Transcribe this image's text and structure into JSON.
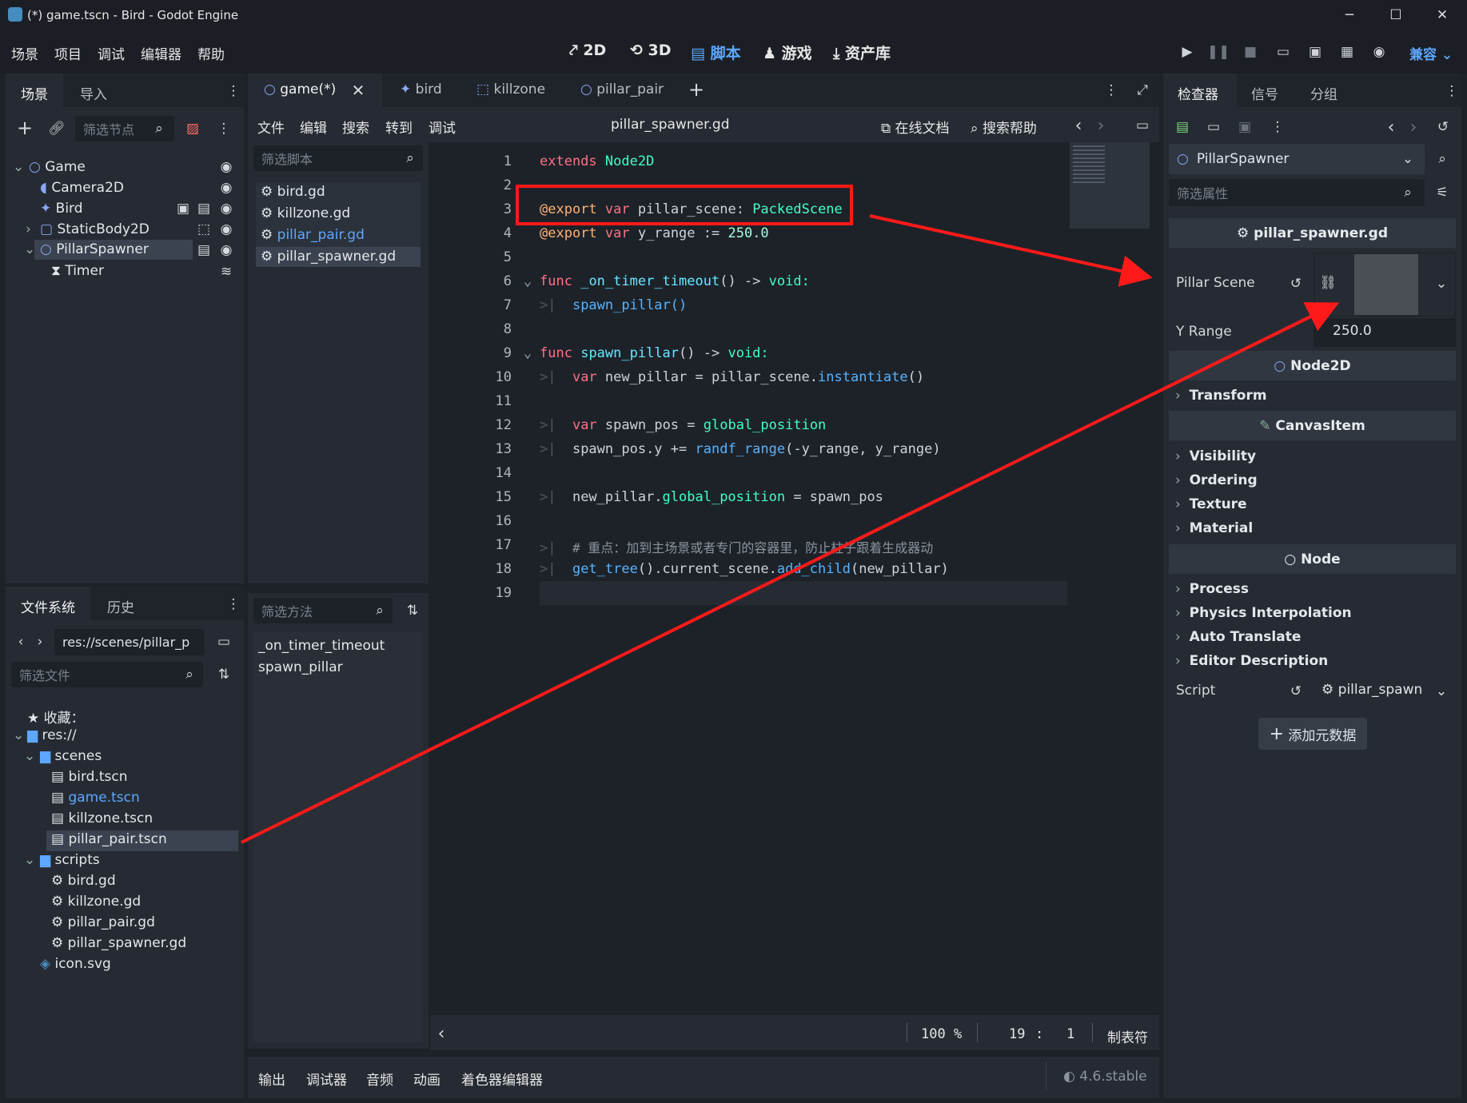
{
  "window": {
    "title": "(*) game.tscn - Bird - Godot Engine",
    "minimize": "─",
    "maximize": "☐",
    "close": "✕"
  },
  "menu": [
    "场景",
    "项目",
    "调试",
    "编辑器",
    "帮助"
  ],
  "workspaces": [
    {
      "label": "2D",
      "icon": "2d-icon"
    },
    {
      "label": "3D",
      "icon": "3d-icon"
    },
    {
      "label": "脚本",
      "icon": "script-icon",
      "active": true
    },
    {
      "label": "游戏",
      "icon": "game-icon"
    },
    {
      "label": "资产库",
      "icon": "assetlib-icon"
    }
  ],
  "renderer": "兼容",
  "scene_dock": {
    "tabs": [
      "场景",
      "导入"
    ],
    "filter_placeholder": "筛选节点",
    "nodes": [
      {
        "name": "Game",
        "icon": "node2d-icon"
      },
      {
        "name": "Camera2D",
        "icon": "camera-icon"
      },
      {
        "name": "Bird",
        "icon": "character-icon"
      },
      {
        "name": "StaticBody2D",
        "icon": "staticbody-icon"
      },
      {
        "name": "PillarSpawner",
        "icon": "node2d-icon",
        "selected": true
      },
      {
        "name": "Timer",
        "icon": "timer-icon"
      }
    ]
  },
  "filesystem": {
    "tabs": [
      "文件系统",
      "历史"
    ],
    "path": "res://scenes/pillar_p",
    "filter_placeholder": "筛选文件",
    "favorites": "收藏：",
    "items": [
      {
        "name": "res://",
        "type": "folder"
      },
      {
        "name": "scenes",
        "type": "folder"
      },
      {
        "name": "bird.tscn",
        "type": "scene"
      },
      {
        "name": "game.tscn",
        "type": "scene",
        "highlight": true
      },
      {
        "name": "killzone.tscn",
        "type": "scene"
      },
      {
        "name": "pillar_pair.tscn",
        "type": "scene",
        "selected": true
      },
      {
        "name": "scripts",
        "type": "folder"
      },
      {
        "name": "bird.gd",
        "type": "script"
      },
      {
        "name": "killzone.gd",
        "type": "script"
      },
      {
        "name": "pillar_pair.gd",
        "type": "script"
      },
      {
        "name": "pillar_spawner.gd",
        "type": "script"
      },
      {
        "name": "icon.svg",
        "type": "image"
      }
    ]
  },
  "scene_tabs": [
    {
      "label": "game(*)",
      "active": true
    },
    {
      "label": "bird"
    },
    {
      "label": "killzone"
    },
    {
      "label": "pillar_pair"
    }
  ],
  "script_menu": [
    "文件",
    "编辑",
    "搜索",
    "转到",
    "调试"
  ],
  "script_name": "pillar_spawner.gd",
  "online_docs": "在线文档",
  "search_help": "搜索帮助",
  "script_list": {
    "filter_placeholder": "筛选脚本",
    "items": [
      "bird.gd",
      "killzone.gd",
      "pillar_pair.gd",
      "pillar_spawner.gd"
    ]
  },
  "method_list": {
    "filter_placeholder": "筛选方法",
    "items": [
      "_on_timer_timeout",
      "spawn_pillar"
    ]
  },
  "code": {
    "line_numbers": [
      "1",
      "2",
      "3",
      "4",
      "5",
      "6",
      "7",
      "8",
      "9",
      "10",
      "11",
      "12",
      "13",
      "14",
      "15",
      "16",
      "17",
      "18",
      "19"
    ],
    "l1a": "extends",
    "l1b": "Node2D",
    "l3a": "@export",
    "l3b": "var",
    "l3c": "pillar_scene:",
    "l3d": "PackedScene",
    "l4a": "@export",
    "l4b": "var",
    "l4c": "y_range :=",
    "l4d": "250.0",
    "l6a": "func",
    "l6b": "_on_timer_timeout",
    "l6c": "() ->",
    "l6d": "void:",
    "l7": "spawn_pillar()",
    "l9a": "func",
    "l9b": "spawn_pillar",
    "l9c": "() ->",
    "l9d": "void:",
    "l10a": "var",
    "l10b": "new_pillar = pillar_scene.",
    "l10c": "instantiate",
    "l10d": "()",
    "l12a": "var",
    "l12b": "spawn_pos =",
    "l12c": "global_position",
    "l13a": "spawn_pos.y +=",
    "l13b": "randf_range",
    "l13c": "(-y_range, y_range)",
    "l15a": "new_pillar.",
    "l15b": "global_position",
    "l15c": "= spawn_pos",
    "l17": "# 重点：加到主场景或者专门的容器里，防止柱子跟着生成器动",
    "l18a": "get_tree",
    "l18b": "().current_scene.",
    "l18c": "add_child",
    "l18d": "(new_pillar)"
  },
  "status": {
    "zoom": "100 %",
    "line": "19",
    "sep": ":",
    "col": "1",
    "indent": "制表符"
  },
  "bottom_tabs": [
    "输出",
    "调试器",
    "音频",
    "动画",
    "着色器编辑器"
  ],
  "version": "4.6.stable",
  "inspector": {
    "tabs": [
      "检查器",
      "信号",
      "分组"
    ],
    "node": "PillarSpawner",
    "filter_placeholder": "筛选属性",
    "script_header": "pillar_spawner.gd",
    "prop_pillar_scene": "Pillar Scene",
    "prop_y_range": "Y Range",
    "y_range_value": "250.0",
    "sec_node2d": "Node2D",
    "grp_transform": "Transform",
    "sec_canvasitem": "CanvasItem",
    "grp_visibility": "Visibility",
    "grp_ordering": "Ordering",
    "grp_texture": "Texture",
    "grp_material": "Material",
    "sec_node": "Node",
    "grp_process": "Process",
    "grp_physics": "Physics Interpolation",
    "grp_autotrans": "Auto Translate",
    "grp_editordesc": "Editor Description",
    "prop_script": "Script",
    "script_value": "pillar_spawn",
    "add_metadata": "添加元数据"
  },
  "colors": {
    "accent": "#5ea7ff",
    "annotation": "#ff1a1a",
    "keyword": "#ff7085",
    "type": "#42ffc2"
  }
}
